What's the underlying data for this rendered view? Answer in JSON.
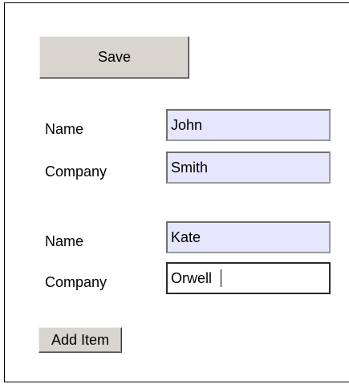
{
  "toolbar": {
    "save_label": "Save",
    "add_item_label": "Add Item"
  },
  "items": [
    {
      "name_label": "Name",
      "name_value": "John",
      "company_label": "Company",
      "company_value": "Smith"
    },
    {
      "name_label": "Name",
      "name_value": "Kate",
      "company_label": "Company",
      "company_value": "Orwell",
      "focused_field": "company"
    }
  ],
  "colors": {
    "button_face": "#d8d5cf",
    "field_background": "#e6e6ff",
    "focused_field_background": "#ffffff",
    "border": "#000000"
  }
}
